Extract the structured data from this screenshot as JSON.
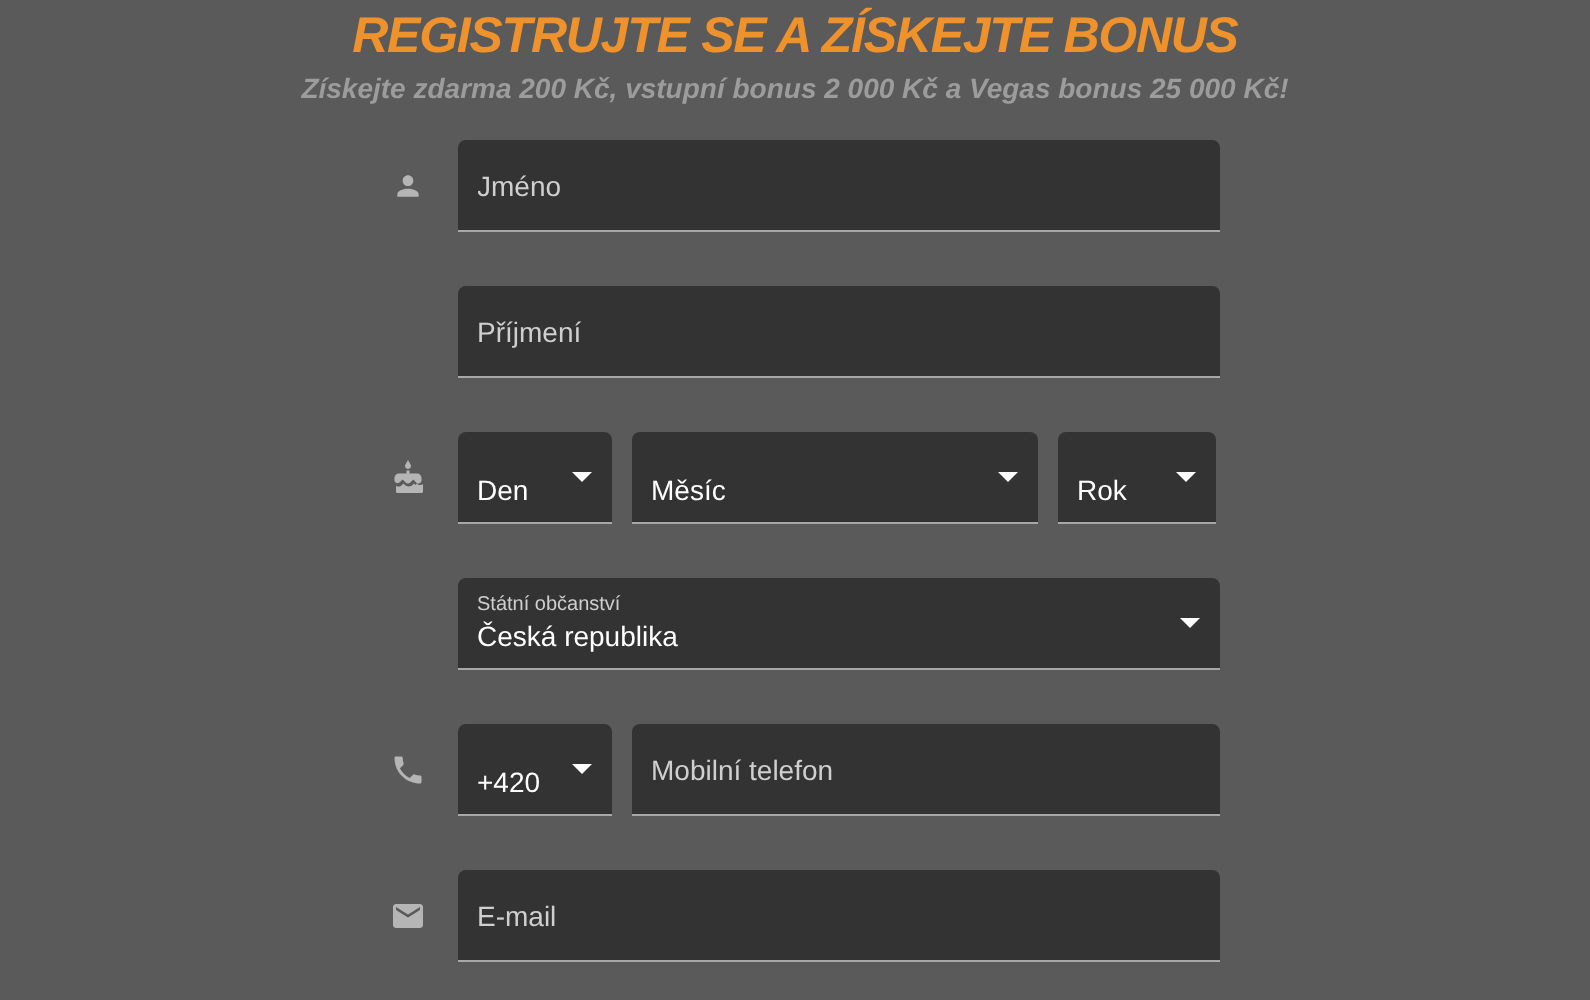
{
  "header": {
    "title": "REGISTRUJTE SE A ZÍSKEJTE BONUS",
    "subtitle": "Získejte zdarma 200 Kč, vstupní bonus 2 000 Kč a Vegas bonus 25 000 Kč!"
  },
  "rows": [
    {
      "kind": "name",
      "fields": [
        {
          "kind": "input",
          "placeholder": "Jméno"
        }
      ]
    },
    {
      "kind": "surname",
      "fields": [
        {
          "kind": "input",
          "placeholder": "Příjmení"
        }
      ]
    },
    {
      "kind": "birthdate",
      "fields": [
        {
          "kind": "select",
          "value": "Den"
        },
        {
          "kind": "select",
          "value": "Měsíc"
        },
        {
          "kind": "select",
          "value": "Rok"
        }
      ]
    },
    {
      "kind": "citizenship",
      "fields": [
        {
          "kind": "select",
          "label": "Státní občanství",
          "value": "Česká republika"
        }
      ]
    },
    {
      "kind": "phone",
      "fields": [
        {
          "kind": "select",
          "value": "+420"
        },
        {
          "kind": "input",
          "placeholder": "Mobilní telefon"
        }
      ]
    },
    {
      "kind": "email",
      "fields": [
        {
          "kind": "input",
          "placeholder": "E-mail"
        }
      ]
    }
  ]
}
